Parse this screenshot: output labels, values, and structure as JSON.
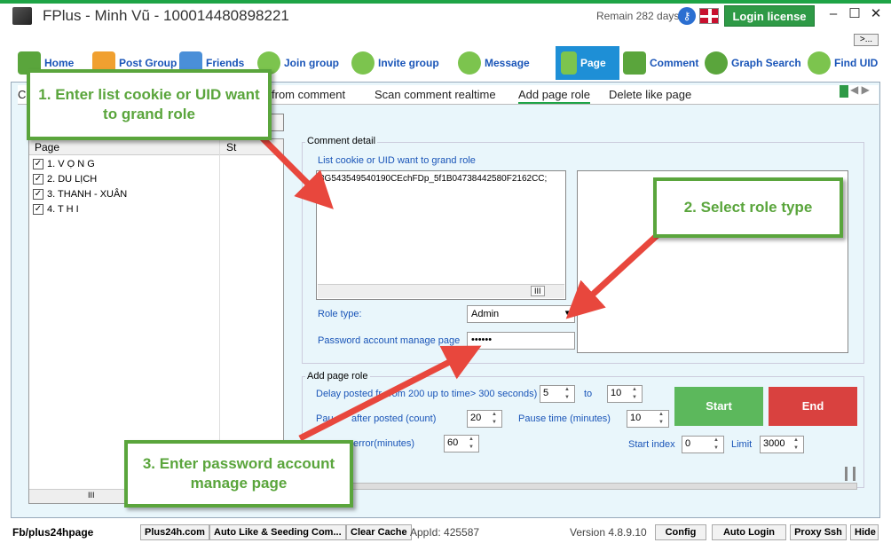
{
  "window": {
    "title": "FPlus - Minh Vũ - 100014480898221",
    "remain": "Remain 282 days",
    "login_license": "Login license",
    "minimize": "–",
    "maximize": "☐",
    "close": "✕",
    "more": ">..."
  },
  "nav": {
    "items": [
      "Home",
      "Post Group",
      "Friends",
      "Join group",
      "Invite group",
      "Message",
      "Page",
      "Comment",
      "Graph Search",
      "Find UID"
    ]
  },
  "tabs": {
    "cut_first": "C",
    "items": [
      "from comment",
      "Scan comment realtime",
      "Add page role",
      "Delete like page"
    ]
  },
  "page_list": {
    "col_page": "Page",
    "col_status": "St",
    "rows": [
      "1. V Ọ N G",
      "2. DU LỊCH",
      "3. THANH - XUÂN",
      "4. T H I"
    ],
    "scroll_mark": "III"
  },
  "comment_detail": {
    "legend": "Comment detail",
    "cookie_label": "List cookie or UID want to grand role",
    "cookie_value": "3G543549540190CEchFDp_5f1B04738442580F2162CC;",
    "scroll_mark": "III",
    "role_label": "Role type:",
    "role_value": "Admin",
    "password_label": "Password account manage page",
    "password_value": "••••••"
  },
  "add_page_role": {
    "legend": "Add page role",
    "delay_label": "Delay posted fr",
    "delay_label_2": "rom 200 up to time> 300 seconds)",
    "delay_from": "5",
    "to_label": "to",
    "delay_to": "10",
    "pause_label": "Pau",
    "pause_label_2": "after posted (count)",
    "pause_count": "20",
    "pause_time_label": "Pause time (minutes)",
    "pause_time": "10",
    "error_label": "error(minutes)",
    "error_value": "60",
    "start_index_label": "Start index",
    "start_index": "0",
    "limit_label": "Limit",
    "limit": "3000",
    "start": "Start",
    "end": "End"
  },
  "callouts": {
    "one": "1. Enter list cookie or UID want to grand role",
    "two": "2. Select role type",
    "three": "3. Enter password account manage page"
  },
  "status": {
    "fb": "Fb/plus24hpage",
    "buttons": [
      "Plus24h.com",
      "Auto Like & Seeding Com...",
      "Clear Cache"
    ],
    "appid": "AppId: 425587",
    "version": "Version 4.8.9.10",
    "right_buttons": [
      "Config",
      "Auto Login",
      "Proxy Ssh",
      "Hide"
    ]
  },
  "colors": {
    "accent": "#1ea446",
    "start": "#5cb85c",
    "end": "#d9413f",
    "callout": "#5aa53c",
    "arrow": "#e8473d"
  }
}
